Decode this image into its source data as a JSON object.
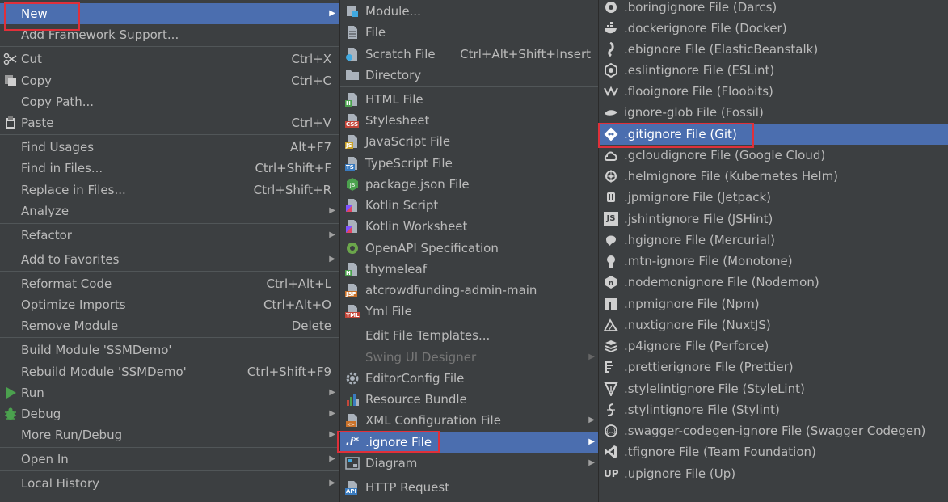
{
  "main_menu": {
    "new": "New",
    "add_framework": "Add Framework Support...",
    "cut": "Cut",
    "cut_sc": "Ctrl+X",
    "copy": "Copy",
    "copy_sc": "Ctrl+C",
    "copy_path": "Copy Path...",
    "paste": "Paste",
    "paste_sc": "Ctrl+V",
    "find_usages": "Find Usages",
    "find_usages_sc": "Alt+F7",
    "find_in_files": "Find in Files...",
    "find_in_files_sc": "Ctrl+Shift+F",
    "replace_in_files": "Replace in Files...",
    "replace_in_files_sc": "Ctrl+Shift+R",
    "analyze": "Analyze",
    "refactor": "Refactor",
    "add_favorites": "Add to Favorites",
    "reformat": "Reformat Code",
    "reformat_sc": "Ctrl+Alt+L",
    "optimize": "Optimize Imports",
    "optimize_sc": "Ctrl+Alt+O",
    "remove_module": "Remove Module",
    "remove_module_sc": "Delete",
    "build_module": "Build Module 'SSMDemo'",
    "rebuild_module": "Rebuild Module 'SSMDemo'",
    "rebuild_module_sc": "Ctrl+Shift+F9",
    "run": "Run",
    "debug": "Debug",
    "more_run": "More Run/Debug",
    "open_in": "Open In",
    "local_history": "Local History"
  },
  "new_menu": {
    "module": "Module...",
    "file": "File",
    "scratch": "Scratch File",
    "scratch_sc": "Ctrl+Alt+Shift+Insert",
    "directory": "Directory",
    "html": "HTML File",
    "stylesheet": "Stylesheet",
    "javascript": "JavaScript File",
    "typescript": "TypeScript File",
    "package_json": "package.json File",
    "kotlin_script": "Kotlin Script",
    "kotlin_worksheet": "Kotlin Worksheet",
    "openapi": "OpenAPI Specification",
    "thymeleaf": "thymeleaf",
    "atcrowd": "atcrowdfunding-admin-main",
    "yml": "Yml File",
    "edit_templates": "Edit File Templates...",
    "swing": "Swing UI Designer",
    "editorconfig": "EditorConfig File",
    "resource_bundle": "Resource Bundle",
    "xml_config": "XML Configuration File",
    "ignore": ".ignore File",
    "diagram": "Diagram",
    "http_request": "HTTP Request"
  },
  "ignore_menu": [
    ".boringignore File (Darcs)",
    ".dockerignore File (Docker)",
    ".ebignore File (ElasticBeanstalk)",
    ".eslintignore File (ESLint)",
    ".flooignore File (Floobits)",
    "ignore-glob File (Fossil)",
    ".gitignore File (Git)",
    ".gcloudignore File (Google Cloud)",
    ".helmignore File (Kubernetes Helm)",
    ".jpmignore File (Jetpack)",
    ".jshintignore File (JSHint)",
    ".hgignore File (Mercurial)",
    ".mtn-ignore File (Monotone)",
    ".nodemonignore File (Nodemon)",
    ".npmignore File (Npm)",
    ".nuxtignore File (NuxtJS)",
    ".p4ignore File (Perforce)",
    ".prettierignore File (Prettier)",
    ".stylelintignore File (StyleLint)",
    ".stylintignore File (Stylint)",
    ".swagger-codegen-ignore File (Swagger Codegen)",
    ".tfignore File (Team Foundation)",
    ".upignore File (Up)"
  ],
  "icon_text": {
    "html": "H",
    "css": "CSS",
    "js": "JS",
    "ts": "TS",
    "jsp": "JSP",
    "yml": "YML",
    "api": "API",
    "ignore": ".i*",
    "jshint": "JS",
    "up": "UP"
  },
  "colors": {
    "background": "#3c3f41",
    "selection": "#4b6eaf",
    "highlight_box": "#e0303a",
    "text": "#bbbbbb"
  }
}
